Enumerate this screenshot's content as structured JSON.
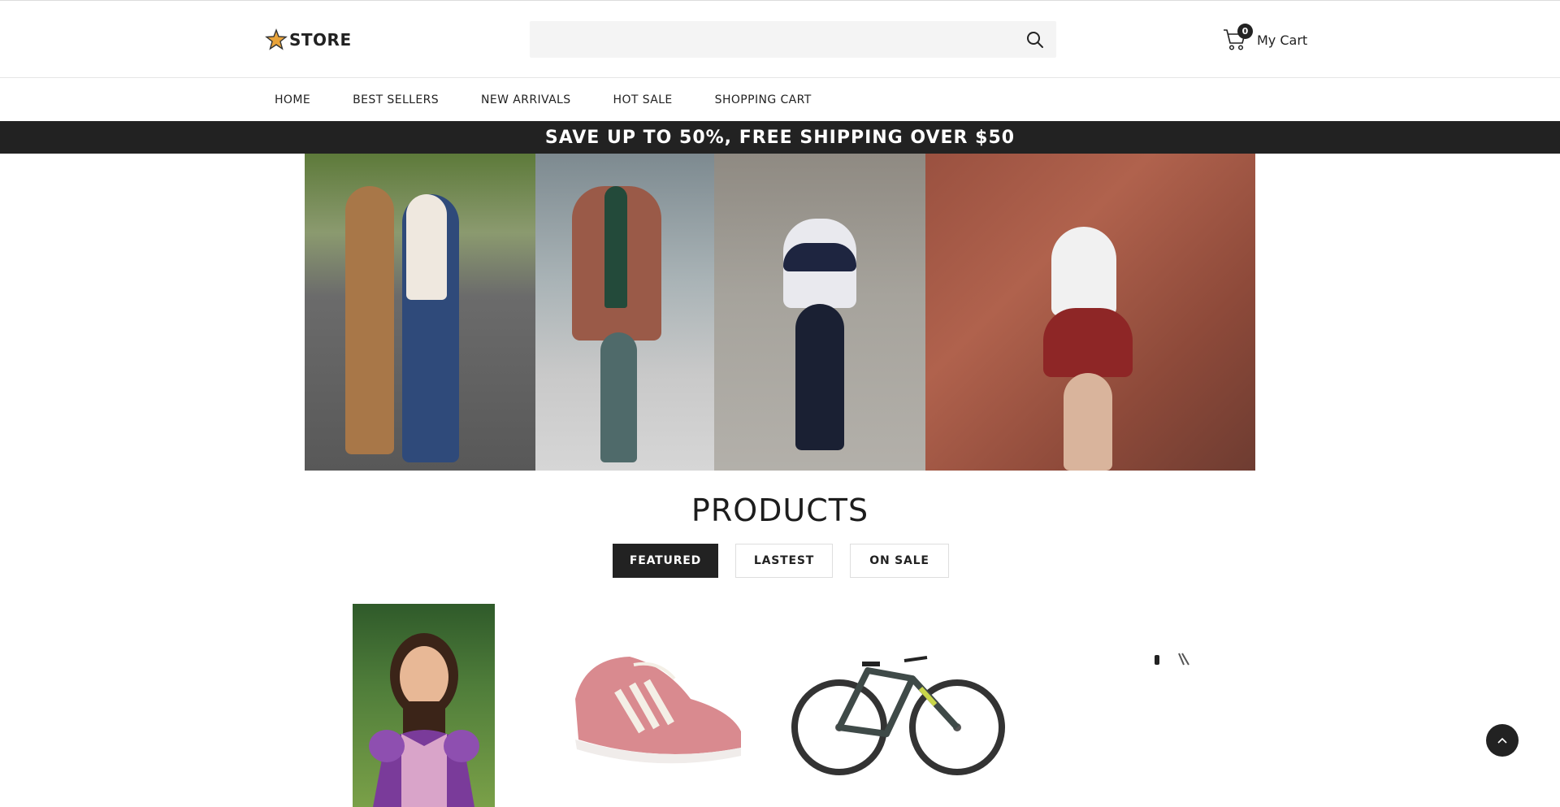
{
  "header": {
    "logo_text": "STORE",
    "search": {
      "placeholder": "",
      "value": ""
    },
    "cart": {
      "count": "0",
      "label": "My Cart"
    }
  },
  "nav": {
    "items": [
      {
        "label": "HOME"
      },
      {
        "label": "BEST SELLERS"
      },
      {
        "label": "NEW ARRIVALS"
      },
      {
        "label": "HOT SALE"
      },
      {
        "label": "SHOPPING CART"
      }
    ]
  },
  "promo": {
    "text": "SAVE UP TO 50%, FREE SHIPPING OVER $50"
  },
  "products": {
    "title": "PRODUCTS",
    "tabs": [
      {
        "label": "FEATURED",
        "active": true
      },
      {
        "label": "LASTEST",
        "active": false
      },
      {
        "label": "ON SALE",
        "active": false
      }
    ]
  },
  "colors": {
    "dark": "#222222",
    "accent_star": "#e8a33a",
    "search_bg": "#f4f4f4"
  }
}
